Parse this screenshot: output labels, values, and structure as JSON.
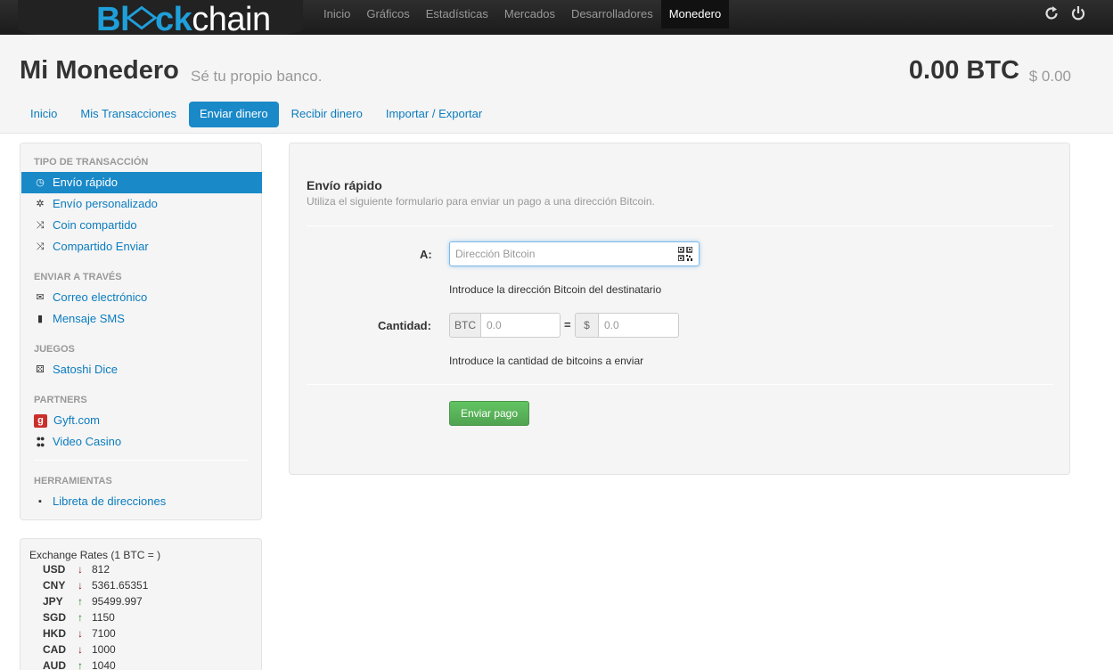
{
  "brand": {
    "part1": "Bl",
    "part2": "ck",
    "part3": "chain"
  },
  "nav": {
    "links": [
      "Inicio",
      "Gráficos",
      "Estadísticas",
      "Mercados",
      "Desarrolladores",
      "Monedero"
    ],
    "active_index": 5,
    "icons": [
      "refresh-icon",
      "power-icon"
    ]
  },
  "header": {
    "title": "Mi Monedero",
    "subtitle": "Sé tu propio banco.",
    "balance": "0.00 BTC",
    "balance_usd": "$ 0.00"
  },
  "tabs": [
    "Inicio",
    "Mis Transacciones",
    "Enviar dinero",
    "Recibir dinero",
    "Importar / Exportar"
  ],
  "active_tab": 2,
  "sidebar": {
    "heading_tx": "TIPO DE TRANSACCIÓN",
    "tx_items": [
      "Envío rápido",
      "Envío personalizado",
      "Coin compartido",
      "Compartido Enviar"
    ],
    "heading_via": "ENVIAR A TRAVÉS",
    "via_items": [
      "Correo electrónico",
      "Mensaje SMS"
    ],
    "heading_games": "JUEGOS",
    "games_items": [
      "Satoshi Dice"
    ],
    "heading_partners": "PARTNERS",
    "partners_items": [
      "Gyft.com",
      "Video Casino"
    ],
    "heading_tools": "HERRAMIENTAS",
    "tools_items": [
      "Libreta de direcciones"
    ]
  },
  "rates": {
    "title": "Exchange Rates (1 BTC = )",
    "rows": [
      {
        "currency": "USD",
        "direction": "down",
        "value": "812"
      },
      {
        "currency": "CNY",
        "direction": "down",
        "value": "5361.65351"
      },
      {
        "currency": "JPY",
        "direction": "up",
        "value": "95499.997"
      },
      {
        "currency": "SGD",
        "direction": "up",
        "value": "1150"
      },
      {
        "currency": "HKD",
        "direction": "down",
        "value": "7100"
      },
      {
        "currency": "CAD",
        "direction": "down",
        "value": "1000"
      },
      {
        "currency": "AUD",
        "direction": "up",
        "value": "1040"
      }
    ]
  },
  "form": {
    "title": "Envío rápido",
    "subtitle": "Utiliza el siguiente formulario para enviar un pago a una dirección Bitcoin.",
    "to_label": "A:",
    "address_placeholder": "Dirección Bitcoin",
    "address_help": "Introduce la dirección Bitcoin del destinatario",
    "amount_label": "Cantidad:",
    "btc_addon": "BTC",
    "btc_placeholder": "0.0",
    "equals": "=",
    "usd_addon": "$",
    "usd_placeholder": "0.0",
    "amount_help": "Introduce la cantidad de bitcoins a enviar",
    "send_button": "Enviar pago"
  },
  "colors": {
    "accent": "#1a89c8",
    "link": "#0a7cbf",
    "success": "#5bb75b",
    "arrow_down": "#8b1c1c",
    "arrow_up": "#2a7a2a"
  }
}
